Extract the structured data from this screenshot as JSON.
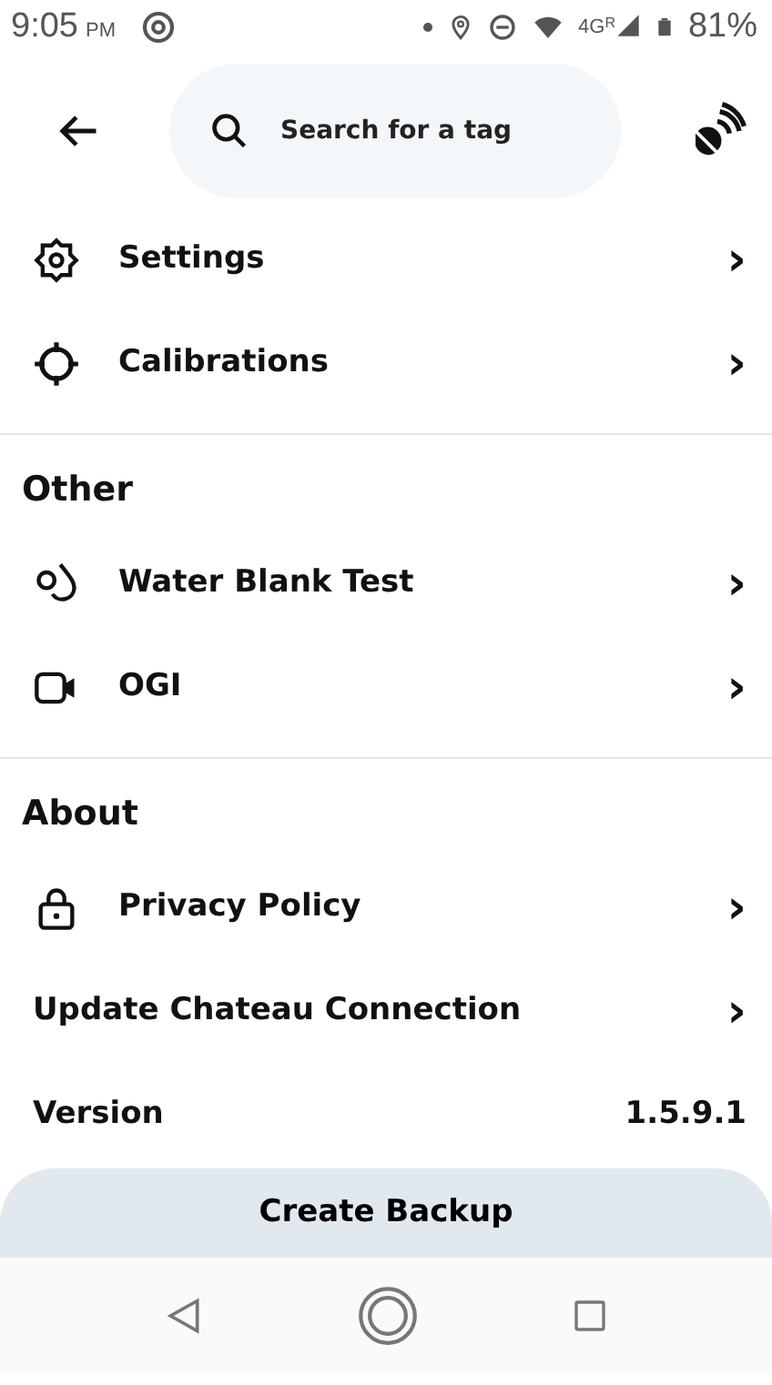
{
  "status_bar": {
    "time": "9:05",
    "meridiem": "PM",
    "network": "4G",
    "roaming": "R",
    "battery": "81%"
  },
  "header": {
    "search": {
      "placeholder": "Search for a tag"
    }
  },
  "sections": [
    {
      "items": [
        {
          "kind": "link",
          "label": "Settings",
          "chevron": "›"
        },
        {
          "kind": "link",
          "label": "Calibrations",
          "chevron": "›"
        }
      ]
    },
    {
      "title": "Other",
      "items": [
        {
          "kind": "link",
          "label": "Water Blank Test",
          "chevron": "›"
        },
        {
          "kind": "link",
          "label": "OGI",
          "chevron": "›"
        }
      ]
    },
    {
      "title": "About",
      "items": [
        {
          "kind": "link",
          "label": "Privacy Policy",
          "chevron": "›"
        },
        {
          "kind": "plain-link",
          "label": "Update Chateau Connection",
          "chevron": "›"
        },
        {
          "kind": "value",
          "label": "Version",
          "value": "1.5.9.1"
        }
      ]
    }
  ],
  "backup_button": {
    "label": "Create Backup"
  }
}
